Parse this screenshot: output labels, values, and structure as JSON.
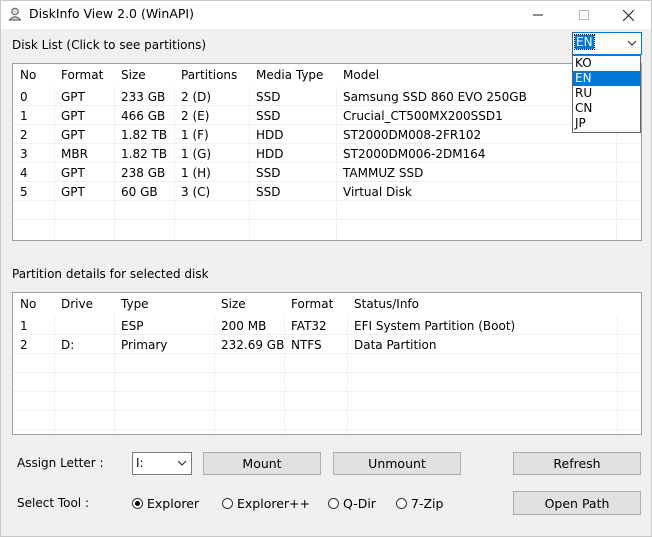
{
  "window": {
    "title": "DiskInfo View 2.0 (WinAPI)",
    "controls": {
      "minimize": "—",
      "maximize": "☐",
      "close": "✕"
    }
  },
  "disk_list": {
    "label": "Disk List (Click to see partitions)",
    "columns": [
      "No",
      "Format",
      "Size",
      "Partitions",
      "Media Type",
      "Model"
    ],
    "rows": [
      [
        "0",
        "GPT",
        "233 GB",
        "2 (D)",
        "SSD",
        "Samsung SSD 860 EVO 250GB"
      ],
      [
        "1",
        "GPT",
        "466 GB",
        "2 (E)",
        "SSD",
        "Crucial_CT500MX200SSD1"
      ],
      [
        "2",
        "GPT",
        "1.82 TB",
        "1 (F)",
        "HDD",
        "ST2000DM008-2FR102"
      ],
      [
        "3",
        "MBR",
        "1.82 TB",
        "1 (G)",
        "HDD",
        "ST2000DM006-2DM164"
      ],
      [
        "4",
        "GPT",
        "238 GB",
        "1 (H)",
        "SSD",
        "TAMMUZ SSD"
      ],
      [
        "5",
        "GPT",
        "60 GB",
        "3 (C)",
        "SSD",
        "Virtual Disk"
      ]
    ]
  },
  "language": {
    "selected": "EN",
    "options": [
      "KO",
      "EN",
      "RU",
      "CN",
      "JP"
    ],
    "highlighted_index": 1
  },
  "partition_details": {
    "label": "Partition details for selected disk",
    "columns": [
      "No",
      "Drive",
      "Type",
      "Size",
      "Format",
      "Status/Info"
    ],
    "rows": [
      [
        "1",
        "",
        "ESP",
        "200 MB",
        "FAT32",
        "EFI System Partition (Boot)"
      ],
      [
        "2",
        "D:",
        "Primary",
        "232.69 GB",
        "NTFS",
        "Data Partition"
      ]
    ]
  },
  "controls": {
    "assign_letter_label": "Assign Letter :",
    "assign_letter_value": "I:",
    "mount_label": "Mount",
    "unmount_label": "Unmount",
    "refresh_label": "Refresh",
    "select_tool_label": "Select Tool :",
    "tools": [
      {
        "label": "Explorer",
        "checked": true
      },
      {
        "label": "Explorer++",
        "checked": false
      },
      {
        "label": "Q-Dir",
        "checked": false
      },
      {
        "label": "7-Zip",
        "checked": false
      }
    ],
    "open_path_label": "Open Path"
  },
  "colors": {
    "accent": "#0078d7",
    "window_bg": "#f0f0f0",
    "list_bg": "#ffffff"
  }
}
